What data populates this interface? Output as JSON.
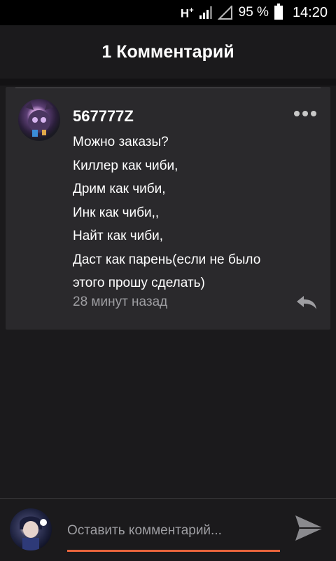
{
  "status_bar": {
    "network": "H",
    "network_sup": "+",
    "battery": "95 %",
    "time": "14:20"
  },
  "header": {
    "title": "1 Комментарий"
  },
  "comment": {
    "username": "567777Z",
    "lines": [
      "Можно заказы?",
      "Киллер как чиби,",
      "Дрим как чиби,",
      "Инк как чиби,,",
      "Найт как чиби,",
      "Даст как парень(если не было",
      "этого  прошу сделать)"
    ],
    "timestamp": "28 минут назад",
    "icons": {
      "more": "more-dots-icon",
      "reply": "reply-icon"
    }
  },
  "input_bar": {
    "placeholder": "Оставить комментарий...",
    "value": "",
    "send_icon": "send-icon"
  },
  "colors": {
    "background": "#1b1a1c",
    "card": "#2a292c",
    "accent": "#e8643c",
    "muted_text": "#9e9ea2"
  }
}
